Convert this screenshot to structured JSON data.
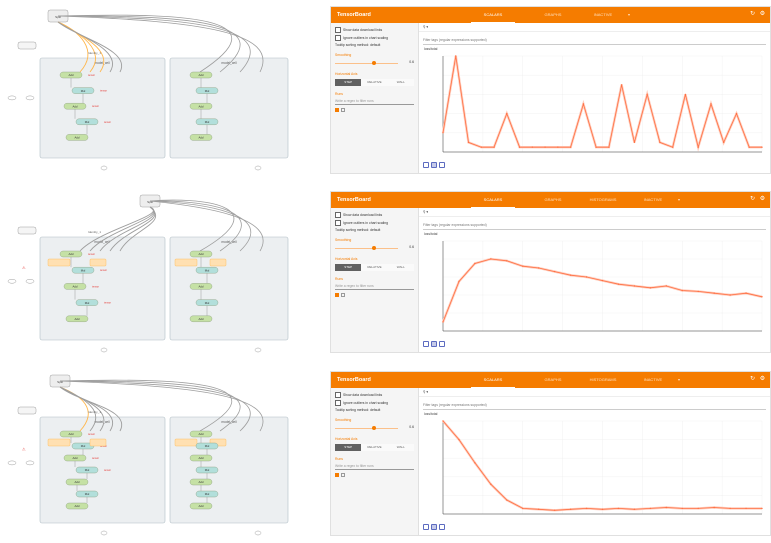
{
  "panels": [
    {
      "graph": {
        "top_node": "Split",
        "scope_left": "model_cell",
        "scope_right": "model_cell",
        "side_label": "Identity_1",
        "nodes_left": [
          "Add",
          "Mul",
          "Add",
          "Mul",
          "Add"
        ],
        "nodes_right": [
          "Add",
          "Mul",
          "Add",
          "Mul",
          "Add"
        ],
        "edge_labels": [
          "tensor",
          "tensor",
          "tensor",
          "tensor"
        ]
      },
      "tensorboard": {
        "title": "TensorBoard",
        "tabs": [
          "SCALARS",
          "GRAPHS",
          "INACTIVE"
        ],
        "active_tab": 0,
        "show_download": "Show data download links",
        "ignore_outliers": "Ignore outliers in chart scaling",
        "tooltip_label": "Tooltip sorting method:",
        "tooltip_value": "default",
        "smoothing_label": "Smoothing",
        "smoothing_value": "0.6",
        "smoothing_fraction": 0.6,
        "horizontal_axis_label": "Horizontal Axis",
        "horizontal_axis_options": [
          "STEP",
          "RELATIVE",
          "WALL"
        ],
        "runs_label": "Runs",
        "runs_placeholder": "Write a regex to filter runs",
        "search_placeholder": "",
        "tag_filter": "Filter tags (regular expressions supported)",
        "chart_label": "loss/total"
      }
    },
    {
      "graph": {
        "top_node": "Split",
        "scope_left": "model_cell",
        "scope_right": "model_cell",
        "side_label": "Identity_1",
        "nodes_left": [
          "Add",
          "Mul",
          "Add",
          "Mul",
          "Add"
        ],
        "nodes_right": [
          "Add",
          "Mul",
          "Add",
          "Mul",
          "Add"
        ],
        "edge_labels": [
          "tensor",
          "tensor",
          "tensor",
          "tensor"
        ]
      },
      "tensorboard": {
        "title": "TensorBoard",
        "tabs": [
          "SCALARS",
          "GRAPHS",
          "HISTOGRAMS",
          "INACTIVE"
        ],
        "active_tab": 0,
        "show_download": "Show data download links",
        "ignore_outliers": "Ignore outliers in chart scaling",
        "tooltip_label": "Tooltip sorting method:",
        "tooltip_value": "default",
        "smoothing_label": "Smoothing",
        "smoothing_value": "0.6",
        "smoothing_fraction": 0.6,
        "horizontal_axis_label": "Horizontal Axis",
        "horizontal_axis_options": [
          "STEP",
          "RELATIVE",
          "WALL"
        ],
        "runs_label": "Runs",
        "runs_placeholder": "Write a regex to filter runs",
        "search_placeholder": "",
        "tag_filter": "Filter tags (regular expressions supported)",
        "chart_label": "loss/total"
      }
    },
    {
      "graph": {
        "top_node": "Split",
        "scope_left": "model_cell",
        "scope_right": "model_cell",
        "side_label": "Identity_1",
        "nodes_left": [
          "Add",
          "Mul",
          "Add",
          "Mul",
          "Add",
          "Mul",
          "Add"
        ],
        "nodes_right": [
          "Add",
          "Mul",
          "Add",
          "Mul",
          "Add",
          "Mul",
          "Add"
        ],
        "edge_labels": [
          "tensor",
          "tensor",
          "tensor",
          "tensor"
        ]
      },
      "tensorboard": {
        "title": "TensorBoard",
        "tabs": [
          "SCALARS",
          "GRAPHS",
          "HISTOGRAMS",
          "INACTIVE"
        ],
        "active_tab": 0,
        "show_download": "Show data download links",
        "ignore_outliers": "Ignore outliers in chart scaling",
        "tooltip_label": "Tooltip sorting method:",
        "tooltip_value": "default",
        "smoothing_label": "Smoothing",
        "smoothing_value": "0.6",
        "smoothing_fraction": 0.6,
        "horizontal_axis_label": "Horizontal Axis",
        "horizontal_axis_options": [
          "STEP",
          "RELATIVE",
          "WALL"
        ],
        "runs_label": "Runs",
        "runs_placeholder": "Write a regex to filter runs",
        "search_placeholder": "",
        "tag_filter": "Filter tags (regular expressions supported)",
        "chart_label": "loss/total"
      }
    }
  ],
  "colors": {
    "accent": "#f57c00",
    "series": "#ff7043",
    "series_raw": "#ffccbc",
    "graph_scope": "#eceff1",
    "graph_node": "#c5e1a5",
    "graph_node_teal": "#b2dfdb",
    "graph_edge_highlight": "#ffb74d"
  },
  "chart_data": [
    {
      "type": "line",
      "title": "loss/total",
      "xlabel": "",
      "ylabel": "",
      "x": [
        0,
        2,
        4,
        6,
        8,
        10,
        12,
        14,
        16,
        18,
        20,
        22,
        24,
        26,
        28,
        30,
        32,
        34,
        36,
        38,
        40,
        42,
        44,
        46,
        48,
        50
      ],
      "series": [
        {
          "values": [
            0.2,
            1.0,
            0.1,
            0.05,
            0.05,
            0.4,
            0.05,
            0.05,
            0.05,
            0.05,
            0.05,
            0.5,
            0.05,
            0.05,
            0.7,
            0.1,
            0.6,
            0.1,
            0.05,
            0.6,
            0.05,
            0.5,
            0.1,
            0.4,
            0.05,
            0.05
          ]
        }
      ],
      "grid": true
    },
    {
      "type": "line",
      "title": "loss/total",
      "xlabel": "",
      "ylabel": "",
      "x": [
        0,
        1,
        2,
        3,
        4,
        5,
        6,
        7,
        8,
        9,
        10,
        11,
        12,
        13,
        14,
        15,
        16,
        17,
        18,
        19,
        20
      ],
      "series": [
        {
          "values": [
            0.1,
            0.55,
            0.75,
            0.8,
            0.78,
            0.72,
            0.7,
            0.66,
            0.62,
            0.6,
            0.56,
            0.52,
            0.5,
            0.48,
            0.5,
            0.45,
            0.44,
            0.42,
            0.4,
            0.42,
            0.38
          ]
        }
      ],
      "grid": true
    },
    {
      "type": "line",
      "title": "loss/total",
      "xlabel": "",
      "ylabel": "",
      "x": [
        0,
        1,
        2,
        3,
        4,
        5,
        6,
        7,
        8,
        9,
        10,
        11,
        12,
        13,
        14,
        15,
        16,
        17,
        18,
        19,
        20
      ],
      "series": [
        {
          "values": [
            1.0,
            0.8,
            0.55,
            0.32,
            0.15,
            0.06,
            0.05,
            0.04,
            0.05,
            0.06,
            0.05,
            0.06,
            0.05,
            0.06,
            0.07,
            0.06,
            0.06,
            0.07,
            0.06,
            0.06,
            0.06
          ]
        }
      ],
      "grid": true
    }
  ]
}
